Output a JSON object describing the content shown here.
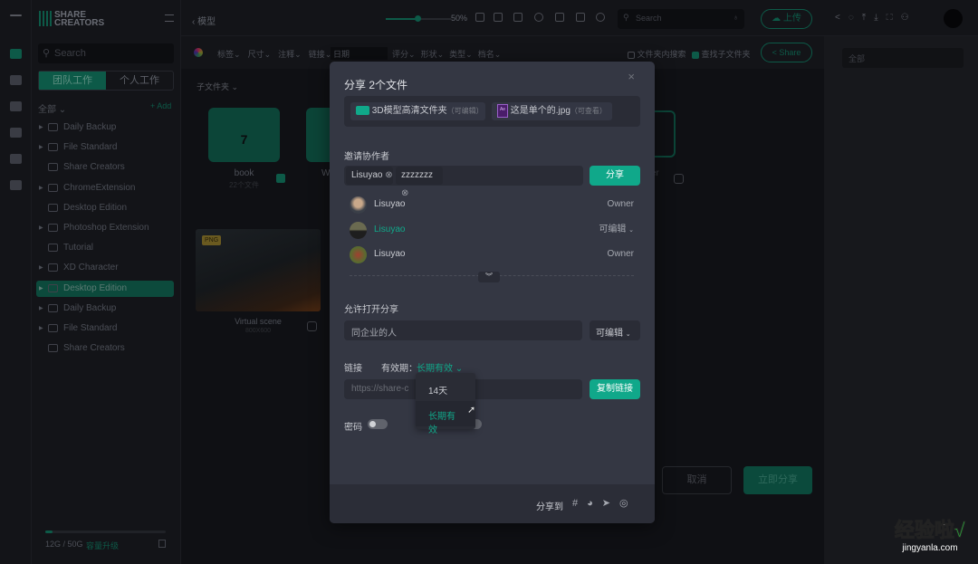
{
  "app": {
    "logo": "SHARE CREATORS",
    "breadcrumb_back": "模型"
  },
  "sidebar": {
    "search_placeholder": "Search",
    "tabs": [
      "团队工作",
      "个人工作"
    ],
    "filter_label": "全部",
    "add_label": "+ Add",
    "items": [
      {
        "label": "Daily Backup",
        "expand": true
      },
      {
        "label": "File Standard",
        "expand": true
      },
      {
        "label": "Share Creators",
        "expand": false
      },
      {
        "label": "ChromeExtension",
        "expand": true
      },
      {
        "label": "Desktop Edition",
        "expand": false
      },
      {
        "label": "Photoshop Extension",
        "expand": true
      },
      {
        "label": "Tutorial",
        "expand": false
      },
      {
        "label": "XD Character",
        "expand": true
      },
      {
        "label": "Desktop Edition",
        "expand": true,
        "selected": true
      },
      {
        "label": "Daily Backup",
        "expand": true
      },
      {
        "label": "File Standard",
        "expand": true
      },
      {
        "label": "Share Creators",
        "expand": false
      }
    ],
    "storage": {
      "text": "12G / 50G",
      "used_fraction": 0.06,
      "upgrade": "容量升级"
    }
  },
  "topbar": {
    "zoom": "50%",
    "zoom_fraction": 0.5,
    "search_placeholder": "Search",
    "upload": "上传"
  },
  "toolbar": {
    "filters": [
      "标签",
      "尺寸",
      "注释",
      "链接"
    ],
    "date_placeholder": "日期",
    "filters2": [
      "评分",
      "形状",
      "类型",
      "档名"
    ],
    "search_in_folder": "文件夹内搜索",
    "search_in_folder_checked": false,
    "find_subfolder": "查找子文件夹",
    "find_subfolder_checked": true,
    "share": "Share"
  },
  "right_panel": {
    "select": "全部"
  },
  "content": {
    "subfolder_label": "子文件夹",
    "folders": [
      {
        "name": "book",
        "count_label": "22个文件",
        "badge": "7",
        "checked": true
      },
      {
        "name": "W"
      }
    ],
    "partial_name": "er",
    "image": {
      "badge": "PNG",
      "name": "Virtual scene",
      "size": "800X600"
    }
  },
  "bg_actions": {
    "cancel": "取消",
    "share_now": "立即分享"
  },
  "modal": {
    "title": "分享 2个文件",
    "files": [
      {
        "name": "3D模型高清文件夹",
        "perm": "（可编辑）",
        "icon": "folder-icon"
      },
      {
        "name": "这是单个的.jpg",
        "perm": "（可查看）",
        "icon": "ae-file-icon"
      }
    ],
    "invite_label": "邀请协作者",
    "invitees": [
      "Lisuyao",
      "zzzzzzz"
    ],
    "share_btn": "分享",
    "members": [
      {
        "name": "Lisuyao",
        "role": "Owner",
        "highlight": false
      },
      {
        "name": "Lisuyao",
        "role": "可编辑",
        "highlight": true
      },
      {
        "name": "Lisuyao",
        "role": "Owner",
        "highlight": false
      }
    ],
    "allow_label": "允许打开分享",
    "allow_value": "同企业的人",
    "allow_perm": "可编辑",
    "link_label": "链接",
    "validity_label": "有效期：",
    "validity_value": "长期有效",
    "link_placeholder": "https://share-c          y.com/",
    "copy_btn": "复制链接",
    "validity_options": [
      "14天",
      "长期有效"
    ],
    "password_label": "密码",
    "password_on": false,
    "share_to": "分享到"
  },
  "colors": {
    "accent": "#10a88a",
    "modal_bg": "#343743",
    "page_bg": "#0f1014"
  },
  "watermark": {
    "text": "经验啦",
    "url": "jingyanla.com"
  }
}
